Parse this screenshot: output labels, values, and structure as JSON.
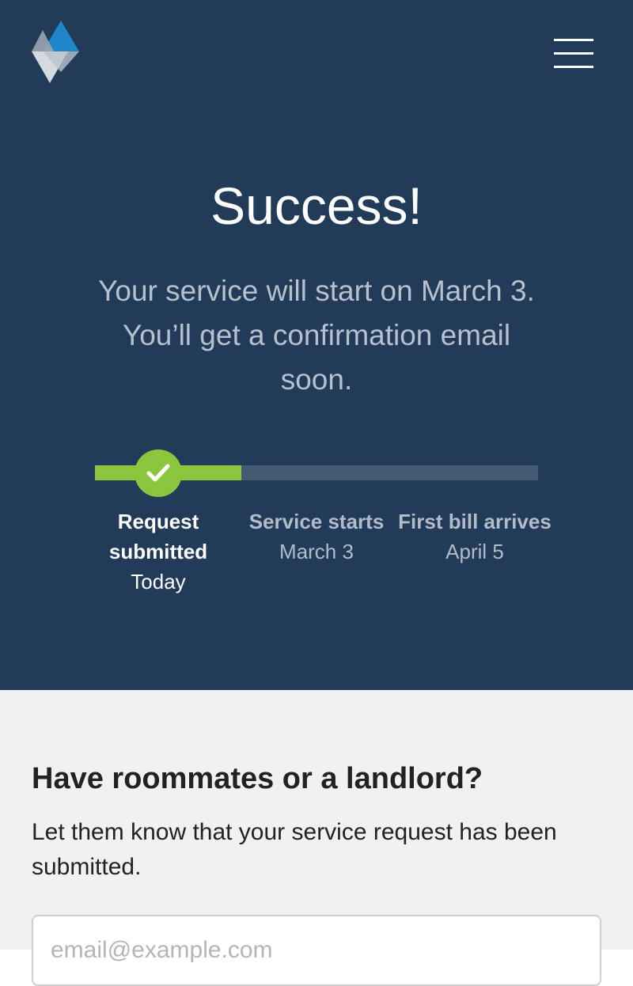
{
  "header": {
    "logo_icon": "diamond-logo-icon",
    "menu_icon": "hamburger-menu-icon"
  },
  "hero": {
    "title": "Success!",
    "message": "Your service will start on March 3. You’ll get a confirmation email soon."
  },
  "progress": {
    "completed_fraction": 0.33,
    "steps": [
      {
        "label": "Request submitted",
        "date": "Today",
        "status": "complete"
      },
      {
        "label": "Service starts",
        "date": "March 3",
        "status": "pending"
      },
      {
        "label": "First bill arrives",
        "date": "April 5",
        "status": "pending"
      }
    ]
  },
  "notify": {
    "heading": "Have roommates or a landlord?",
    "body": "Let them know that your service request has been submitted.",
    "email_placeholder": "email@example.com"
  },
  "colors": {
    "hero_bg": "#213b58",
    "accent_green": "#8cc63f",
    "track_gray": "#445a72",
    "lower_bg": "#f1f1f1"
  }
}
